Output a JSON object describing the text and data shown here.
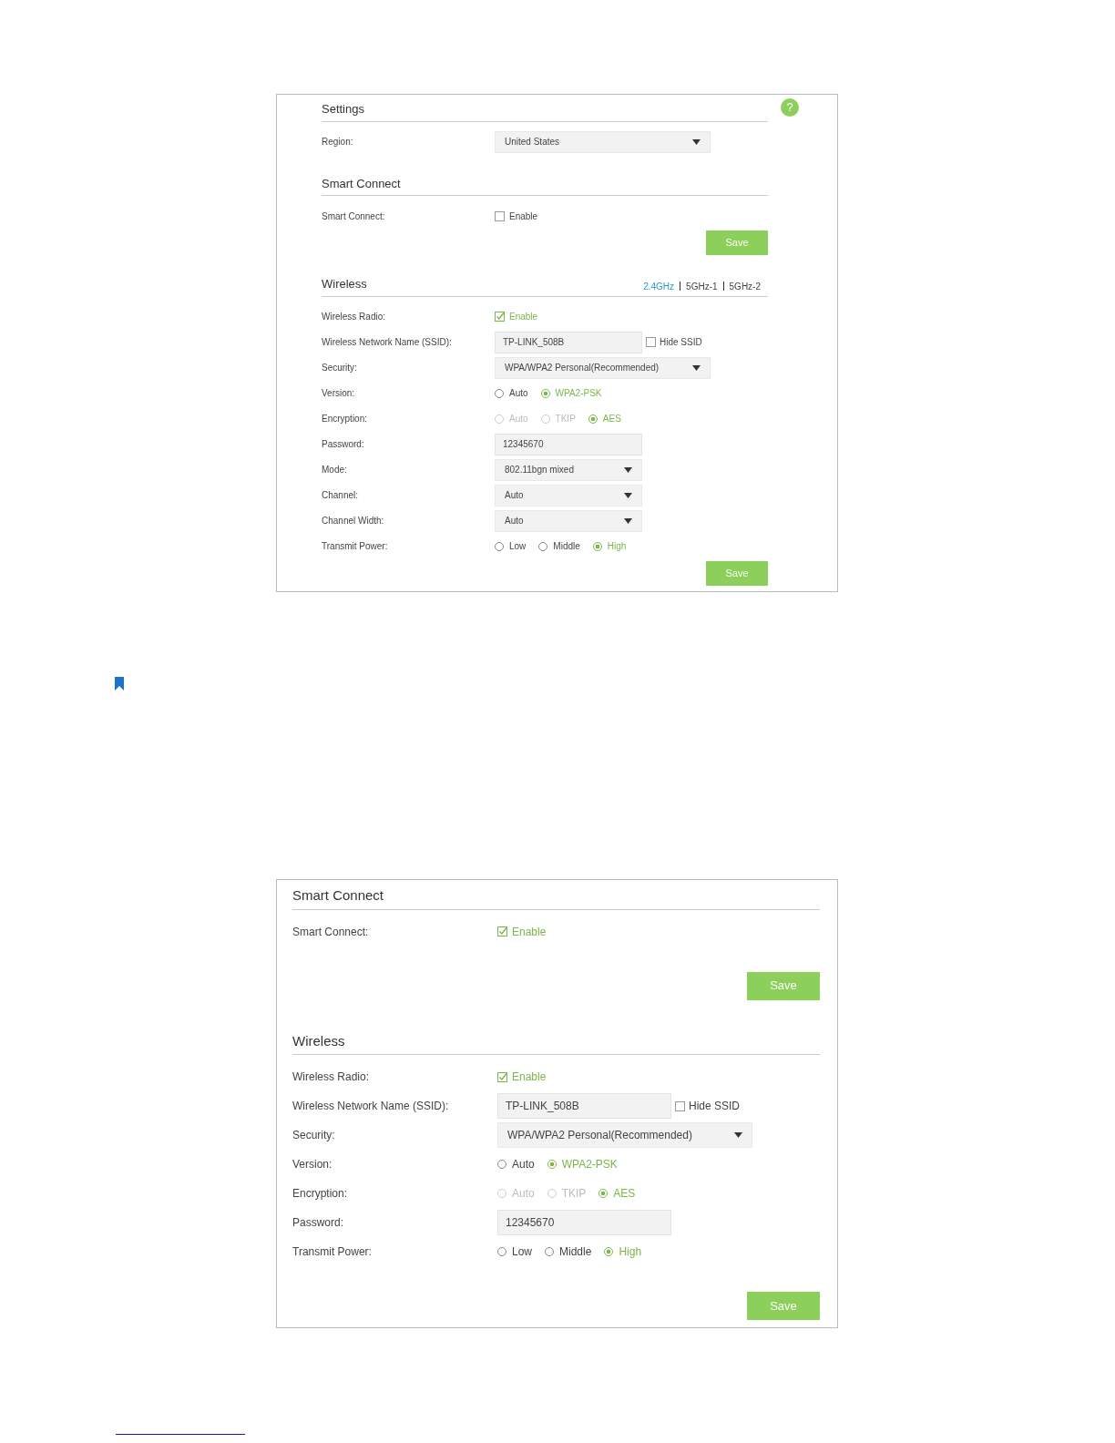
{
  "panels": [
    {
      "help": "?",
      "sections": [
        {
          "title": "Settings",
          "rows": [
            {
              "kind": "wideselect",
              "label": "Region:",
              "value": "United States"
            }
          ]
        },
        {
          "title": "Smart Connect",
          "rows": [
            {
              "kind": "checkbox",
              "label": "Smart Connect:",
              "option": "Enable",
              "checked": false
            },
            {
              "kind": "save",
              "text": "Save"
            }
          ]
        },
        {
          "title": "Wireless",
          "bands": [
            {
              "label": "2.4GHz",
              "selected": true
            },
            {
              "label": "5GHz-1",
              "selected": false
            },
            {
              "label": "5GHz-2",
              "selected": false
            }
          ],
          "rows": [
            {
              "kind": "checkbox",
              "label": "Wireless Radio:",
              "option": "Enable",
              "checked": true
            },
            {
              "kind": "textcheck",
              "label": "Wireless Network Name (SSID):",
              "value": "TP-LINK_508B",
              "option": "Hide SSID",
              "checked": false
            },
            {
              "kind": "wideselect",
              "label": "Security:",
              "value": "WPA/WPA2 Personal(Recommended)"
            },
            {
              "kind": "radios",
              "label": "Version:",
              "options": [
                {
                  "label": "Auto",
                  "selected": false,
                  "disabled": false
                },
                {
                  "label": "WPA2-PSK",
                  "selected": true,
                  "disabled": false
                }
              ]
            },
            {
              "kind": "radios",
              "label": "Encryption:",
              "options": [
                {
                  "label": "Auto",
                  "selected": false,
                  "disabled": true
                },
                {
                  "label": "TKIP",
                  "selected": false,
                  "disabled": true
                },
                {
                  "label": "AES",
                  "selected": true,
                  "disabled": false
                }
              ]
            },
            {
              "kind": "text",
              "label": "Password:",
              "value": "12345670"
            },
            {
              "kind": "select",
              "label": "Mode:",
              "value": "802.11bgn mixed"
            },
            {
              "kind": "select",
              "label": "Channel:",
              "value": "Auto"
            },
            {
              "kind": "select",
              "label": "Channel Width:",
              "value": "Auto"
            },
            {
              "kind": "radios",
              "label": "Transmit Power:",
              "options": [
                {
                  "label": "Low",
                  "selected": false,
                  "disabled": false
                },
                {
                  "label": "Middle",
                  "selected": false,
                  "disabled": false
                },
                {
                  "label": "High",
                  "selected": true,
                  "disabled": false
                }
              ]
            },
            {
              "kind": "save",
              "text": "Save"
            }
          ]
        }
      ]
    },
    {
      "sections": [
        {
          "title": "Smart Connect",
          "rows": [
            {
              "kind": "checkbox",
              "label": "Smart Connect:",
              "option": "Enable",
              "checked": true
            },
            {
              "kind": "save",
              "text": "Save"
            }
          ]
        },
        {
          "title": "Wireless",
          "rows": [
            {
              "kind": "checkbox",
              "label": "Wireless Radio:",
              "option": "Enable",
              "checked": true
            },
            {
              "kind": "textcheck",
              "label": "Wireless Network Name (SSID):",
              "value": "TP-LINK_508B",
              "option": "Hide SSID",
              "checked": false
            },
            {
              "kind": "wideselect",
              "label": "Security:",
              "value": "WPA/WPA2 Personal(Recommended)"
            },
            {
              "kind": "radios",
              "label": "Version:",
              "options": [
                {
                  "label": "Auto",
                  "selected": false,
                  "disabled": false
                },
                {
                  "label": "WPA2-PSK",
                  "selected": true,
                  "disabled": false
                }
              ]
            },
            {
              "kind": "radios",
              "label": "Encryption:",
              "options": [
                {
                  "label": "Auto",
                  "selected": false,
                  "disabled": true
                },
                {
                  "label": "TKIP",
                  "selected": false,
                  "disabled": true
                },
                {
                  "label": "AES",
                  "selected": true,
                  "disabled": false
                }
              ]
            },
            {
              "kind": "text",
              "label": "Password:",
              "value": "12345670"
            },
            {
              "kind": "radios",
              "label": "Transmit Power:",
              "options": [
                {
                  "label": "Low",
                  "selected": false,
                  "disabled": false
                },
                {
                  "label": "Middle",
                  "selected": false,
                  "disabled": false
                },
                {
                  "label": "High",
                  "selected": true,
                  "disabled": false
                }
              ]
            },
            {
              "kind": "save",
              "text": "Save"
            }
          ]
        }
      ]
    }
  ]
}
